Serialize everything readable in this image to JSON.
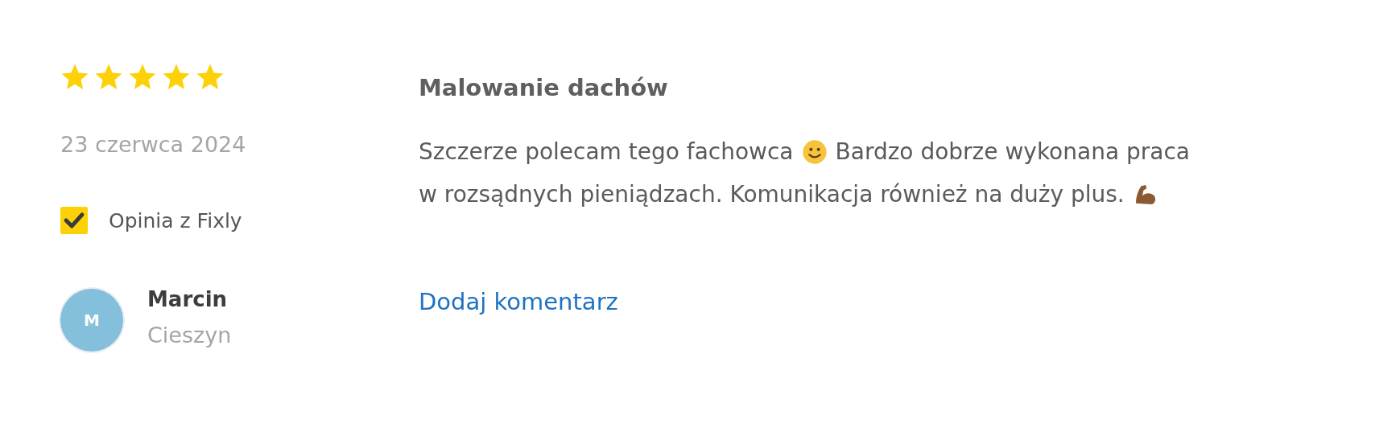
{
  "review": {
    "stars": 5,
    "date": "23 czerwca 2024",
    "verified": {
      "label": "Opinia z Fixly",
      "checked": true
    },
    "author": {
      "initial": "M",
      "name": "Marcin",
      "city": "Cieszyn"
    },
    "title": "Malowanie dachów",
    "body_lines": [
      [
        {
          "kind": "text",
          "text": "Szczerze polecam tego fachowca"
        },
        {
          "kind": "smile"
        },
        {
          "kind": "text",
          "text": "Bardzo dobrze wykonana praca"
        }
      ],
      [
        {
          "kind": "text",
          "text": "w rozsądnych pieniądzach. Komunikacja również na duży plus."
        },
        {
          "kind": "muscle"
        }
      ]
    ],
    "comment_link": "Dodaj komentarz"
  }
}
